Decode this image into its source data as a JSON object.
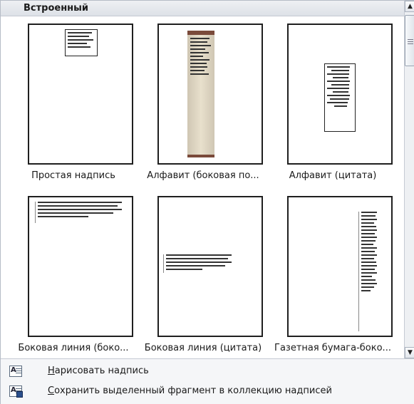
{
  "gallery": {
    "section_title": "Встроенный",
    "items": [
      {
        "label": "Простая надпись",
        "icon": "simple-textbox-thumbnail"
      },
      {
        "label": "Алфавит (боковая по...",
        "icon": "alphabet-sidebar-thumbnail"
      },
      {
        "label": "Алфавит (цитата)",
        "icon": "alphabet-quote-thumbnail"
      },
      {
        "label": "Боковая линия (боко...",
        "icon": "sideline-sidebar-thumbnail"
      },
      {
        "label": "Боковая линия (цитата)",
        "icon": "sideline-quote-thumbnail"
      },
      {
        "label": "Газетная бумага-боко...",
        "icon": "newsprint-sidebar-thumbnail"
      }
    ]
  },
  "commands": [
    {
      "accel": "Н",
      "rest": "арисовать надпись",
      "icon": "draw-textbox-icon"
    },
    {
      "accel": "С",
      "rest": "охранить выделенный фрагмент в коллекцию надписей",
      "icon": "save-selection-icon"
    }
  ],
  "scrollbar": {
    "up": "▲",
    "down": "▼",
    "more": "≡"
  }
}
